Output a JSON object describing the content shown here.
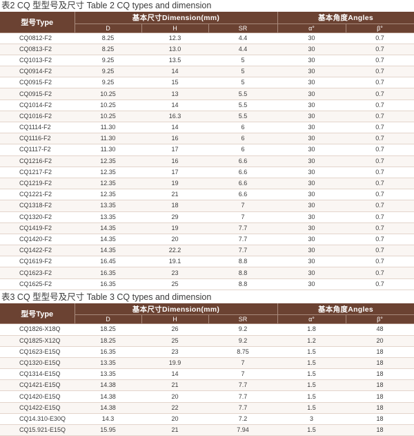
{
  "table2": {
    "caption": "表2 CQ 型型号及尺寸  Table 2 CQ types and dimension",
    "type_header": "型号Type",
    "dim_header": "基本尺寸Dimension(mm)",
    "angle_header": "基本角度Angles",
    "col_d": "D",
    "col_h": "H",
    "col_sr": "SR",
    "col_alpha": "α°",
    "col_beta": "β°",
    "rows": [
      [
        "CQ0812-F2",
        "8.25",
        "12.3",
        "4.4",
        "30",
        "0.7"
      ],
      [
        "CQ0813-F2",
        "8.25",
        "13.0",
        "4.4",
        "30",
        "0.7"
      ],
      [
        "CQ1013-F2",
        "9.25",
        "13.5",
        "5",
        "30",
        "0.7"
      ],
      [
        "CQ0914-F2",
        "9.25",
        "14",
        "5",
        "30",
        "0.7"
      ],
      [
        "CQ0915-F2",
        "9.25",
        "15",
        "5",
        "30",
        "0.7"
      ],
      [
        "CQ0915-F2",
        "10.25",
        "13",
        "5.5",
        "30",
        "0.7"
      ],
      [
        "CQ1014-F2",
        "10.25",
        "14",
        "5.5",
        "30",
        "0.7"
      ],
      [
        "CQ1016-F2",
        "10.25",
        "16.3",
        "5.5",
        "30",
        "0.7"
      ],
      [
        "CQ1114-F2",
        "11.30",
        "14",
        "6",
        "30",
        "0.7"
      ],
      [
        "CQ1116-F2",
        "11.30",
        "16",
        "6",
        "30",
        "0.7"
      ],
      [
        "CQ1117-F2",
        "11.30",
        "17",
        "6",
        "30",
        "0.7"
      ],
      [
        "CQ1216-F2",
        "12.35",
        "16",
        "6.6",
        "30",
        "0.7"
      ],
      [
        "CQ1217-F2",
        "12.35",
        "17",
        "6.6",
        "30",
        "0.7"
      ],
      [
        "CQ1219-F2",
        "12.35",
        "19",
        "6.6",
        "30",
        "0.7"
      ],
      [
        "CQ1221-F2",
        "12.35",
        "21",
        "6.6",
        "30",
        "0.7"
      ],
      [
        "CQ1318-F2",
        "13.35",
        "18",
        "7",
        "30",
        "0.7"
      ],
      [
        "CQ1320-F2",
        "13.35",
        "29",
        "7",
        "30",
        "0.7"
      ],
      [
        "CQ1419-F2",
        "14.35",
        "19",
        "7.7",
        "30",
        "0.7"
      ],
      [
        "CQ1420-F2",
        "14.35",
        "20",
        "7.7",
        "30",
        "0.7"
      ],
      [
        "CQ1422-F2",
        "14.35",
        "22.2",
        "7.7",
        "30",
        "0.7"
      ],
      [
        "CQ1619-F2",
        "16.45",
        "19.1",
        "8.8",
        "30",
        "0.7"
      ],
      [
        "CQ1623-F2",
        "16.35",
        "23",
        "8.8",
        "30",
        "0.7"
      ],
      [
        "CQ1625-F2",
        "16.35",
        "25",
        "8.8",
        "30",
        "0.7"
      ]
    ]
  },
  "table3": {
    "caption": "表3 CQ 型型号及尺寸  Table 3 CQ types and dimension",
    "type_header": "型号Type",
    "dim_header": "基本尺寸Dimension(mm)",
    "angle_header": "基本角度Angles",
    "col_d": "D",
    "col_h": "H",
    "col_sr": "SR",
    "col_alpha": "α°",
    "col_beta": "β°",
    "rows": [
      [
        "CQ1826-X18Q",
        "18.25",
        "26",
        "9.2",
        "1.8",
        "48"
      ],
      [
        "CQ1825-X12Q",
        "18.25",
        "25",
        "9.2",
        "1.2",
        "20"
      ],
      [
        "CQ1623-E15Q",
        "16.35",
        "23",
        "8.75",
        "1.5",
        "18"
      ],
      [
        "CQ1320-E15Q",
        "13.35",
        "19.9",
        "7",
        "1.5",
        "18"
      ],
      [
        "CQ1314-E15Q",
        "13.35",
        "14",
        "7",
        "1.5",
        "18"
      ],
      [
        "CQ1421-E15Q",
        "14.38",
        "21",
        "7.7",
        "1.5",
        "18"
      ],
      [
        "CQ1420-E15Q",
        "14.38",
        "20",
        "7.7",
        "1.5",
        "18"
      ],
      [
        "CQ1422-E15Q",
        "14.38",
        "22",
        "7.7",
        "1.5",
        "18"
      ],
      [
        "CQ14.310-E30Q",
        "14.3",
        "20",
        "7.2",
        "3",
        "18"
      ],
      [
        "CQ15.921-E15Q",
        "15.95",
        "21",
        "7.94",
        "1.5",
        "18"
      ]
    ]
  }
}
